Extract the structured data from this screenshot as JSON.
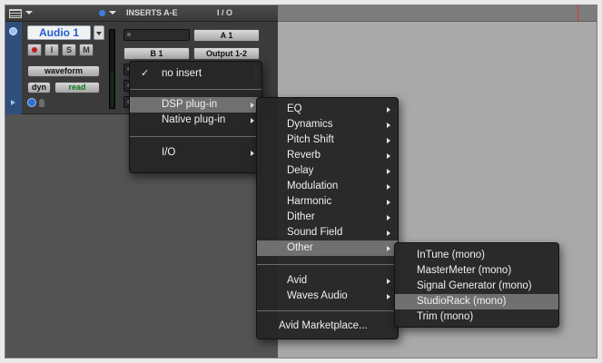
{
  "track": {
    "name": "Audio 1",
    "buttons": [
      "I",
      "S",
      "M"
    ],
    "view": "waveform",
    "dyn": "dyn",
    "automation_mode": "read",
    "inserts_header": "INSERTS A-E",
    "io_header": "I / O",
    "input": "A 1",
    "bus_label": "B 1",
    "output": "Output 1-2"
  },
  "menu_main": {
    "items": [
      {
        "label": "no insert",
        "checked_mark": "✓"
      },
      {
        "label": "DSP plug-in"
      },
      {
        "label": "Native plug-in"
      },
      {
        "label": "I/O"
      }
    ]
  },
  "menu_categories": {
    "items": [
      {
        "label": "EQ"
      },
      {
        "label": "Dynamics"
      },
      {
        "label": "Pitch Shift"
      },
      {
        "label": "Reverb"
      },
      {
        "label": "Delay"
      },
      {
        "label": "Modulation"
      },
      {
        "label": "Harmonic"
      },
      {
        "label": "Dither"
      },
      {
        "label": "Sound Field"
      },
      {
        "label": "Other"
      },
      {
        "label": "Avid"
      },
      {
        "label": "Waves Audio"
      },
      {
        "label": "Avid Marketplace..."
      }
    ]
  },
  "menu_other": {
    "items": [
      {
        "label": "InTune (mono)"
      },
      {
        "label": "MasterMeter (mono)"
      },
      {
        "label": "Signal Generator (mono)"
      },
      {
        "label": "StudioRack (mono)"
      },
      {
        "label": "Trim (mono)"
      }
    ]
  },
  "colors": {
    "highlight": "#707070",
    "track_name_text": "#1f5fd1",
    "read_text": "#0b7a1e",
    "timeline_marker": "#dd3333"
  },
  "icons": {
    "list": "list-icon",
    "record": "record-icon",
    "voice": "voice-icon",
    "person": "person-icon",
    "submenu": "chevron-right-icon"
  }
}
